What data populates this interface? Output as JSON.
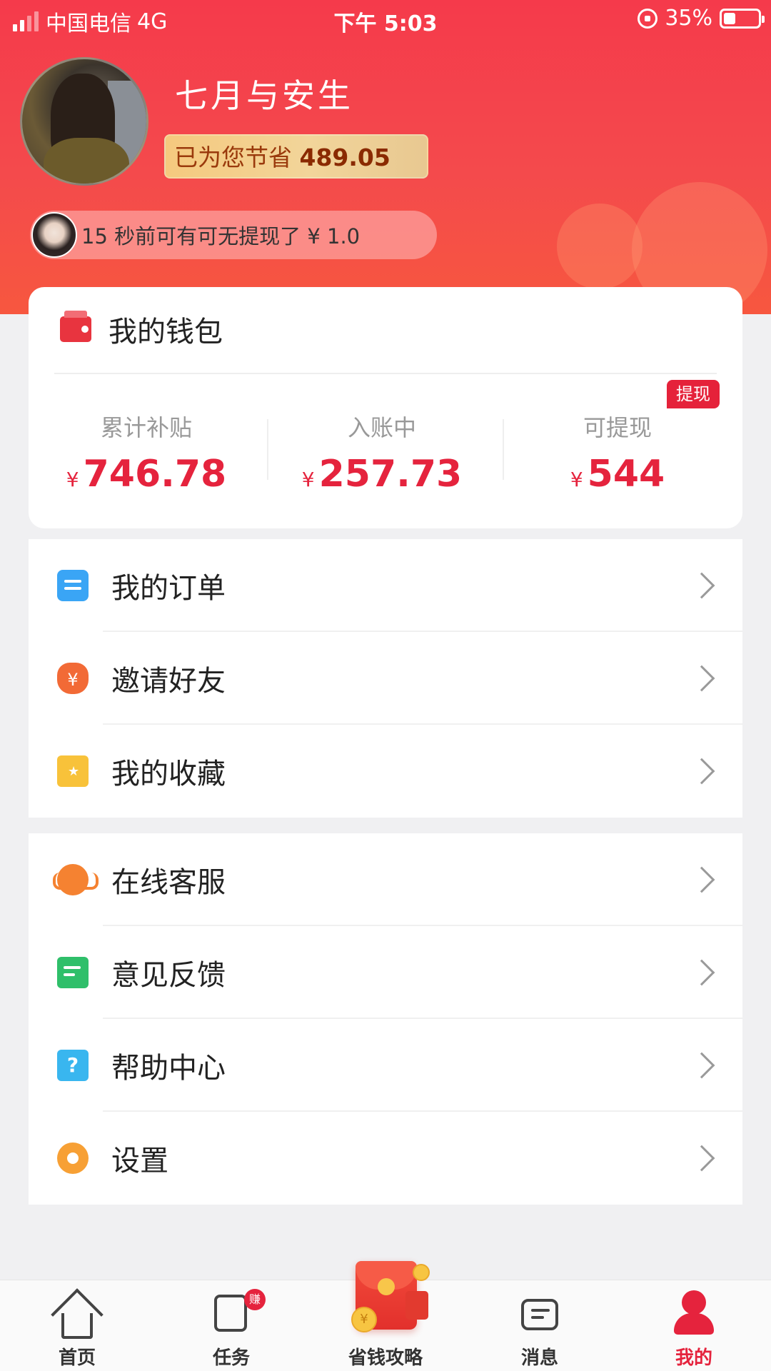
{
  "status_bar": {
    "carrier": "中国电信",
    "network": "4G",
    "time": "下午 5:03",
    "battery_percent": "35%",
    "battery_level": 0.35
  },
  "profile": {
    "username": "七月与安生",
    "saved_prefix": "已为您节省",
    "saved_amount": "489.05",
    "ticker_text": "15 秒前可有可无提现了 ¥ 1.0"
  },
  "wallet": {
    "title": "我的钱包",
    "withdraw_tag": "提现",
    "currency_symbol": "¥",
    "stats": [
      {
        "label": "累计补贴",
        "value": "746.78"
      },
      {
        "label": "入账中",
        "value": "257.73"
      },
      {
        "label": "可提现",
        "value": "544"
      }
    ]
  },
  "menu_group_1": [
    {
      "label": "我的订单",
      "icon": "order-icon"
    },
    {
      "label": "邀请好友",
      "icon": "invite-icon"
    },
    {
      "label": "我的收藏",
      "icon": "favorites-icon"
    }
  ],
  "menu_group_2": [
    {
      "label": "在线客服",
      "icon": "customer-service-icon"
    },
    {
      "label": "意见反馈",
      "icon": "feedback-icon"
    },
    {
      "label": "帮助中心",
      "icon": "help-icon"
    },
    {
      "label": "设置",
      "icon": "settings-icon"
    }
  ],
  "tabbar": {
    "items": [
      {
        "label": "首页",
        "icon": "home-icon"
      },
      {
        "label": "任务",
        "icon": "task-icon",
        "badge": "赚"
      },
      {
        "label": "省钱攻略",
        "icon": "red-packet-icon"
      },
      {
        "label": "消息",
        "icon": "message-icon"
      },
      {
        "label": "我的",
        "icon": "profile-icon"
      }
    ],
    "active_index": 4
  },
  "colors": {
    "header_red": "#f53a4b",
    "accent_red": "#e5233d",
    "gold_badge": "#f5c97e"
  }
}
